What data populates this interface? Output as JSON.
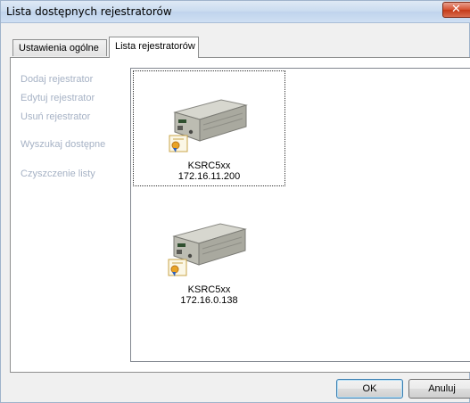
{
  "window": {
    "title": "Lista dostępnych rejestratorów",
    "close_glyph": "✕"
  },
  "tabs": [
    {
      "label": "Ustawienia ogólne"
    },
    {
      "label": "Lista rejestratorów"
    }
  ],
  "actions": {
    "add": "Dodaj rejestrator",
    "edit": "Edytuj rejestrator",
    "remove": "Usuń rejestrator",
    "search": "Wyszukaj dostępne",
    "clear": "Czyszczenie listy"
  },
  "devices": [
    {
      "name": "KSRC5xx",
      "ip": "172.16.11.200"
    },
    {
      "name": "KSRC5xx",
      "ip": "172.16.0.138"
    }
  ],
  "buttons": {
    "ok": "OK",
    "cancel": "Anuluj"
  }
}
